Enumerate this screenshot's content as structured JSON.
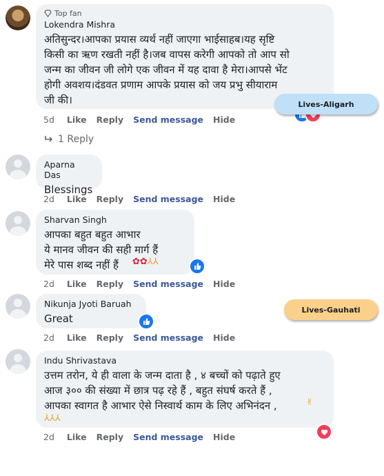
{
  "comments": [
    {
      "badge": "Top fan",
      "author": "Lokendra Mishra",
      "text": "अतिसुन्दर।आपका प्रयास व्यर्थ नहीं जाएगा भाईसाहब।यह सृष्टि\nकिसी का ऋण रखती नहीं है।जब वापस करेगी आपको तो आप सो\nजन्म का जीवन जी लोगे एक जीवन में यह दावा है मेरा।आपसे भेंट\nहोगी अवशय।दंडवत प्रणाम आपके प्रयास को जय प्रभु सीयाराम\nजी की।",
      "time": "5d",
      "actions": {
        "like": "Like",
        "reply": "Reply",
        "send": "Send message",
        "hide": "Hide"
      },
      "replies": "1 Reply"
    },
    {
      "author": "Aparna Das",
      "text": "Blessings",
      "time": "2d",
      "actions": {
        "like": "Like",
        "reply": "Reply",
        "send": "Send message",
        "hide": "Hide"
      }
    },
    {
      "author": "Sharvan Singh",
      "text": "आपका बहुत बहुत आभार\nये मानव जीवन की सही मार्ग हैं\nमेरे पास शब्द नहीं हैं",
      "time": "2d",
      "actions": {
        "like": "Like",
        "reply": "Reply",
        "send": "Send message",
        "hide": "Hide"
      }
    },
    {
      "author": "Nikunja Jyoti Baruah",
      "text": "Great",
      "time": "2d",
      "actions": {
        "like": "Like",
        "reply": "Reply",
        "send": "Send message",
        "hide": "Hide"
      }
    },
    {
      "author": "Indu Shrivastava",
      "text": "उत्तम तरोन, ये ही वाला के जन्म दाता है , ४ बच्चों को पढ़ाते हुए\nआज ३०० की संख्या में छात्र पढ़ रहे हैं , बहुत संघर्ष करते हैं ,\nआपका स्वागत है आभार ऐसे निस्वार्थ काम के लिए अभिनंदन ,",
      "time": "2d",
      "actions": {
        "like": "Like",
        "reply": "Reply",
        "send": "Send message",
        "hide": "Hide"
      }
    }
  ],
  "callouts": [
    {
      "label": "Lives-Aligarh",
      "color": "#bfe0f7"
    },
    {
      "label": "Lives-Gauhati",
      "color": "#fbd08a"
    }
  ],
  "colors": {
    "bubble": "#eff2f5",
    "link": "#3b5998",
    "muted": "#65676b",
    "like": "#1877f2",
    "love": "#f33e58"
  }
}
